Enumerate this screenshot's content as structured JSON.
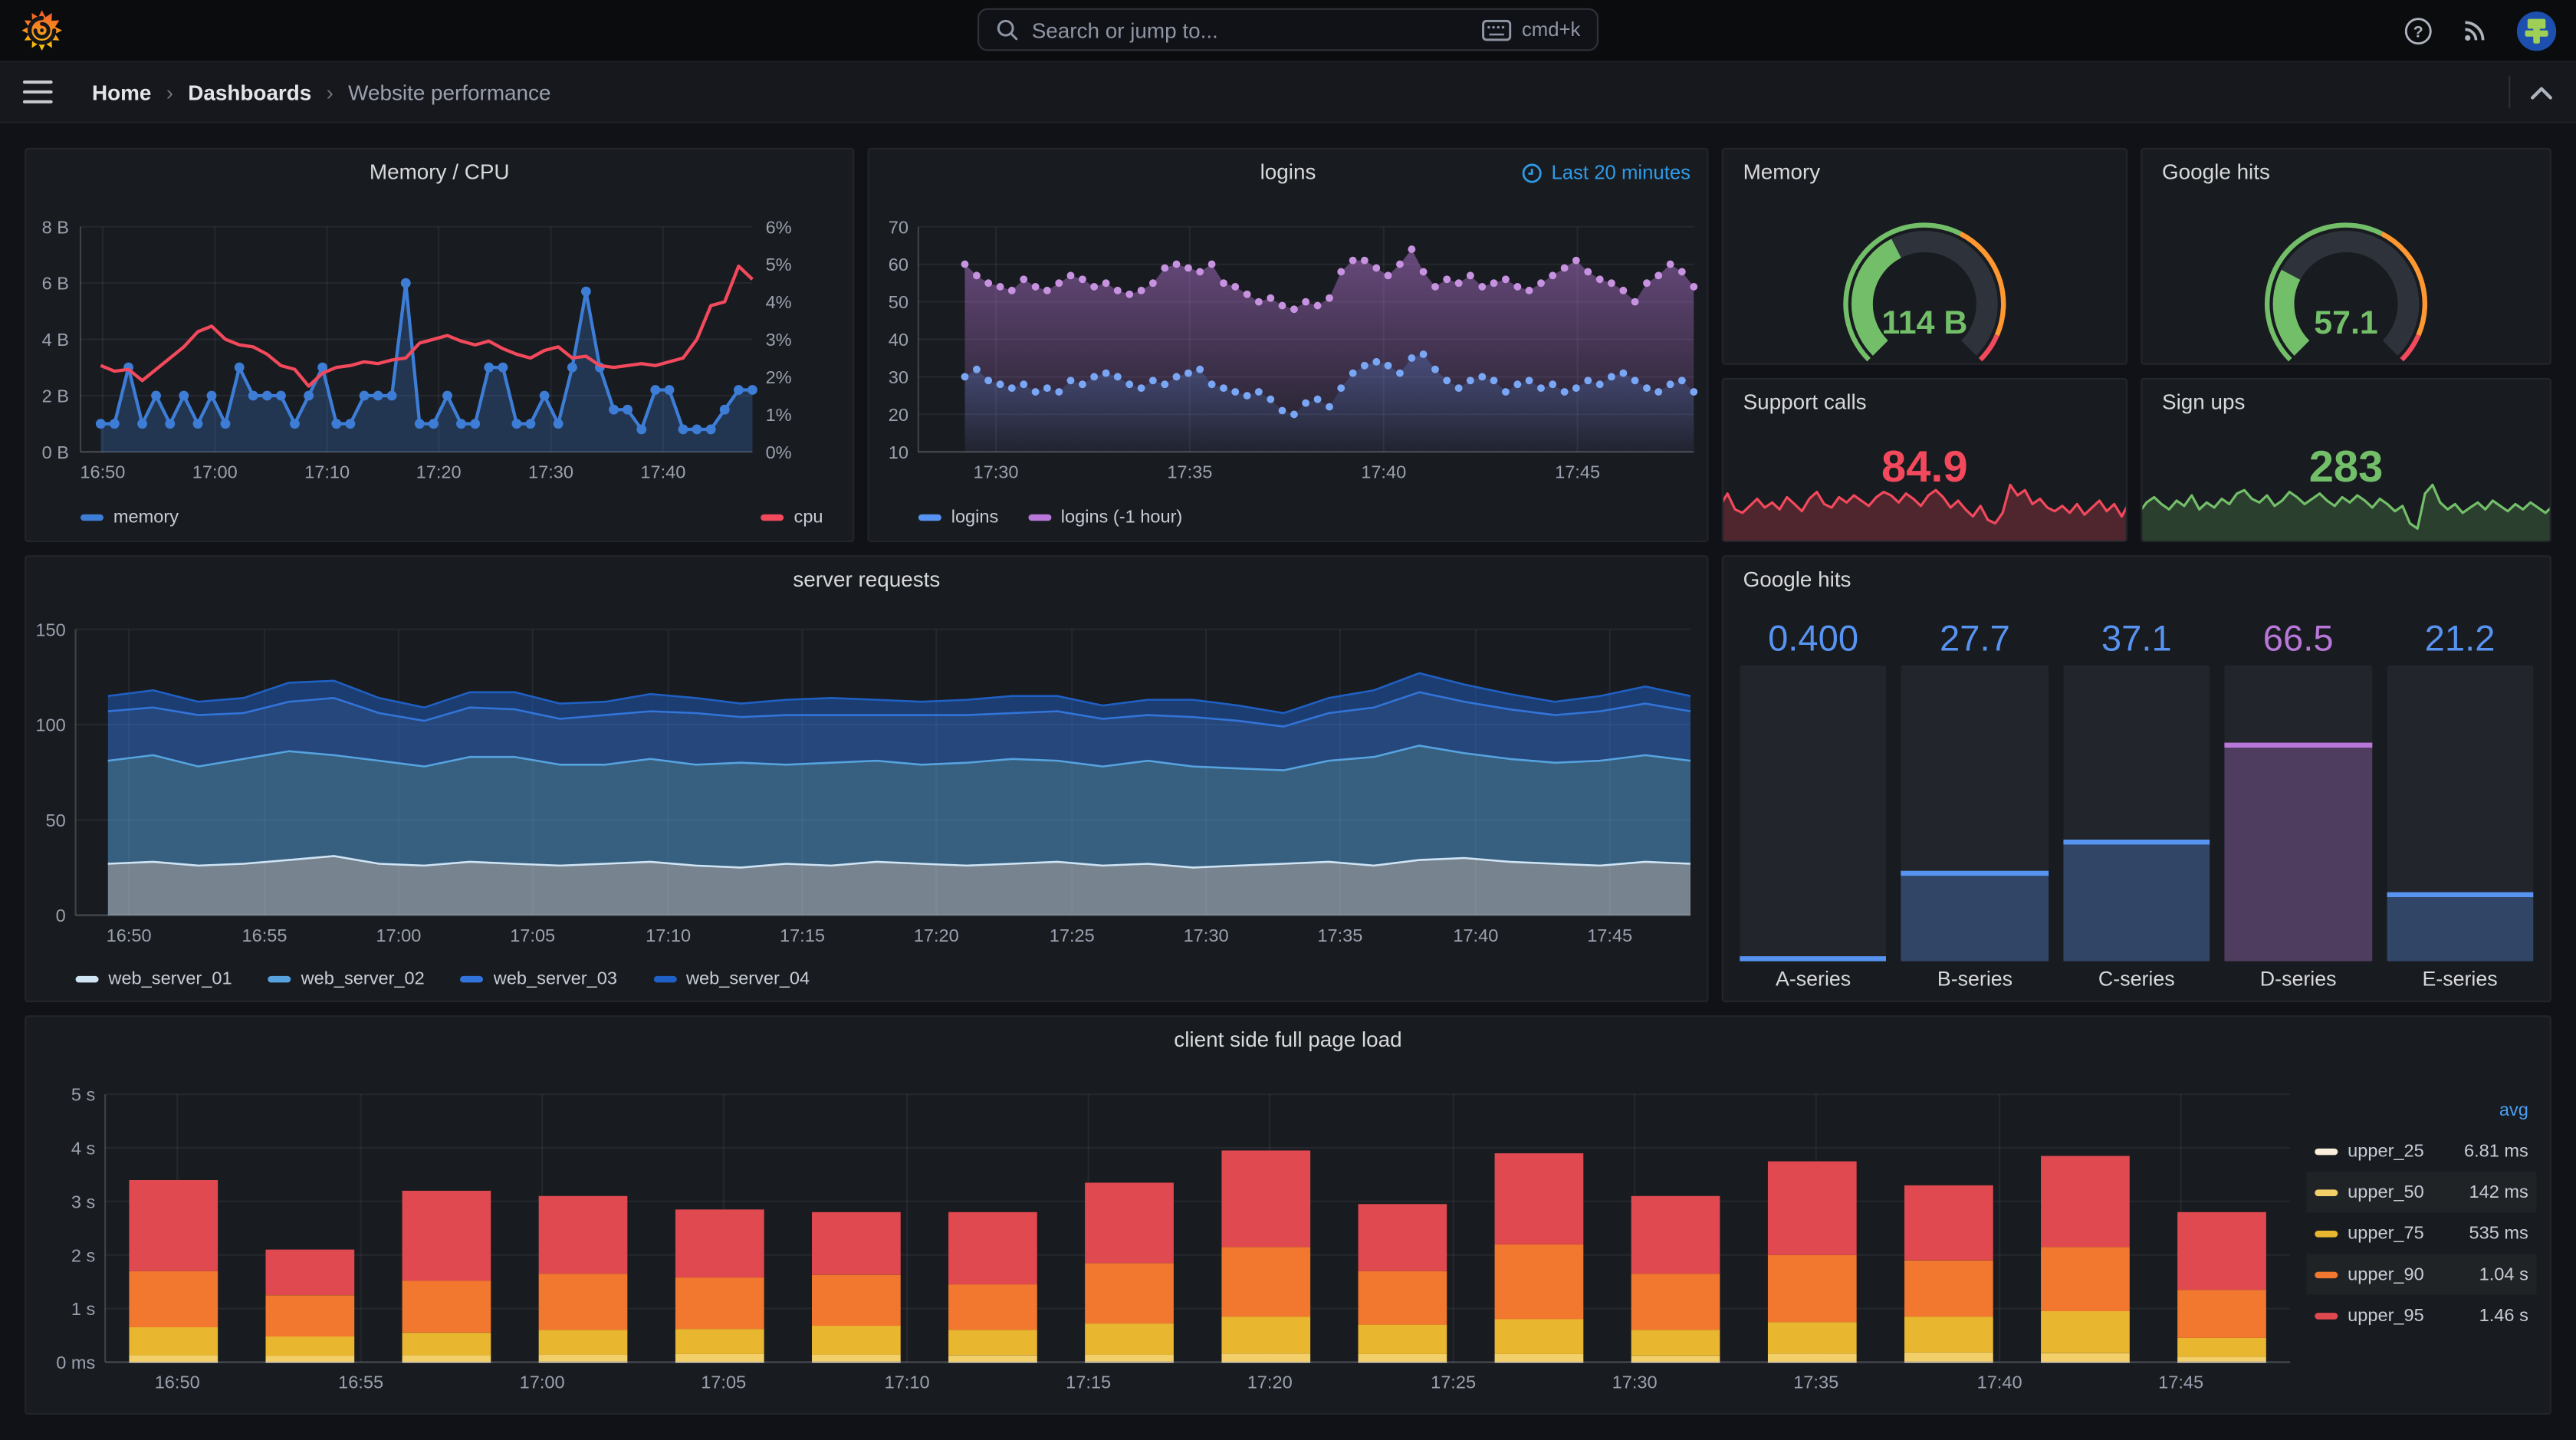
{
  "ui": {
    "topnav": {
      "search_placeholder": "Search or jump to...",
      "shortcut_label": "cmd+k",
      "icons": [
        "grafana-logo",
        "search-icon",
        "keyboard-icon",
        "help-icon",
        "rss-icon",
        "user-avatar"
      ]
    },
    "breadcrumb": {
      "items": [
        "Home",
        "Dashboards",
        "Website performance"
      ],
      "separator": "›"
    },
    "colors": {
      "page_bg": "#111217",
      "panel_bg": "#181b1f",
      "accent_blue": "#5794F2",
      "purple": "#B877D9",
      "green": "#73BF69",
      "red": "#F2495C",
      "orange": "#FF9830",
      "link_blue": "#2f9be8"
    }
  },
  "chart_data": [
    {
      "id": "memory_cpu",
      "type": "line",
      "title": "Memory / CPU",
      "x_ticks": [
        "16:50",
        "17:00",
        "17:10",
        "17:20",
        "17:30",
        "17:40"
      ],
      "x_tick_fracs": [
        0.033,
        0.2,
        0.367,
        0.533,
        0.7,
        0.867
      ],
      "y_left": {
        "ticks": [
          "8 B",
          "6 B",
          "4 B",
          "2 B",
          "0 B"
        ],
        "min": 0,
        "max": 8
      },
      "y_right": {
        "ticks": [
          "6%",
          "5%",
          "4%",
          "3%",
          "2%",
          "1%",
          "0%"
        ],
        "min": 0,
        "max": 6
      },
      "series": [
        {
          "name": "memory",
          "axis": "left",
          "color": "#3D7DD6",
          "fill": "rgba(61,125,214,0.28)",
          "values": [
            1,
            1,
            3,
            1,
            2,
            1,
            2,
            1,
            2,
            1,
            3,
            2,
            2,
            2,
            1,
            2,
            3,
            1,
            1,
            2,
            2,
            2,
            6,
            1,
            1,
            2,
            1,
            1,
            3,
            3,
            1,
            1,
            2,
            1,
            3,
            5.7,
            3,
            1.5,
            1.5,
            0.8,
            2.2,
            2.2,
            0.8,
            0.8,
            0.8,
            1.5,
            2.2,
            2.2
          ]
        },
        {
          "name": "cpu",
          "axis": "right",
          "color": "#F2495C",
          "values": [
            2.3,
            2.15,
            2.2,
            1.9,
            2.2,
            2.5,
            2.8,
            3.2,
            3.35,
            3.0,
            2.85,
            2.8,
            2.6,
            2.3,
            2.2,
            1.75,
            2.1,
            2.25,
            2.3,
            2.4,
            2.35,
            2.45,
            2.5,
            2.9,
            3.0,
            3.1,
            2.95,
            2.85,
            2.95,
            2.75,
            2.6,
            2.5,
            2.7,
            2.8,
            2.5,
            2.55,
            2.3,
            2.25,
            2.3,
            2.35,
            2.3,
            2.4,
            2.5,
            3.0,
            3.9,
            4.0,
            4.95,
            4.6
          ]
        }
      ]
    },
    {
      "id": "logins",
      "type": "scatter-area",
      "title": "logins",
      "time_range": "Last 20 minutes",
      "x_ticks": [
        "17:30",
        "17:35",
        "17:40",
        "17:45"
      ],
      "x_tick_fracs": [
        0.1,
        0.35,
        0.6,
        0.85
      ],
      "y_ticks": [
        70,
        60,
        50,
        40,
        30,
        20,
        10
      ],
      "ylim": [
        10,
        70
      ],
      "series": [
        {
          "name": "logins",
          "color": "#5794F2",
          "dot": "#7AA7F5",
          "values": [
            30,
            32,
            29,
            28,
            27,
            28,
            26,
            27,
            26,
            29,
            28,
            30,
            31,
            30,
            28,
            27,
            29,
            28,
            30,
            31,
            32,
            28,
            27,
            26,
            25,
            26,
            24,
            21,
            20,
            23,
            24,
            22,
            27,
            31,
            33,
            34,
            33,
            31,
            35,
            36,
            32,
            29,
            27,
            29,
            30,
            29,
            26,
            28,
            29,
            27,
            28,
            26,
            27,
            29,
            28,
            30,
            31,
            29,
            27,
            26,
            28,
            29,
            26
          ]
        },
        {
          "name": "logins (-1 hour)",
          "color": "#B877D9",
          "dot": "#C792E0",
          "values": [
            60,
            57,
            55,
            54,
            53,
            56,
            54,
            53,
            55,
            57,
            56,
            54,
            55,
            53,
            52,
            53,
            55,
            59,
            60,
            59,
            58,
            60,
            55,
            54,
            52,
            50,
            51,
            49,
            48,
            50,
            49,
            51,
            58,
            61,
            61,
            59,
            57,
            60,
            64,
            58,
            54,
            56,
            55,
            57,
            54,
            55,
            56,
            54,
            53,
            55,
            57,
            59,
            61,
            58,
            56,
            55,
            53,
            50,
            55,
            57,
            60,
            58,
            54
          ]
        }
      ]
    },
    {
      "id": "server_requests",
      "type": "area-stacked",
      "title": "server requests",
      "x_ticks": [
        "16:50",
        "16:55",
        "17:00",
        "17:05",
        "17:10",
        "17:15",
        "17:20",
        "17:25",
        "17:30",
        "17:35",
        "17:40",
        "17:45"
      ],
      "x_tick_fracs": [
        0.033,
        0.117,
        0.2,
        0.283,
        0.367,
        0.45,
        0.533,
        0.617,
        0.7,
        0.783,
        0.867,
        0.95
      ],
      "y_ticks": [
        150,
        100,
        50,
        0
      ],
      "ylim": [
        0,
        150
      ],
      "series": [
        {
          "name": "web_server_01",
          "color": "#CFE4F5",
          "fill": "rgba(207,228,245,0.52)",
          "values": [
            27,
            28,
            26,
            27,
            29,
            31,
            27,
            26,
            28,
            27,
            26,
            27,
            28,
            26,
            25,
            27,
            26,
            28,
            27,
            26,
            27,
            28,
            26,
            27,
            25,
            26,
            27,
            28,
            26,
            29,
            30,
            28,
            27,
            26,
            28,
            27
          ]
        },
        {
          "name": "web_server_02",
          "color": "#56A3E0",
          "fill": "rgba(86,163,224,0.5)",
          "values": [
            54,
            56,
            52,
            55,
            57,
            53,
            54,
            52,
            55,
            56,
            53,
            52,
            54,
            53,
            55,
            52,
            54,
            53,
            52,
            54,
            55,
            53,
            52,
            54,
            53,
            51,
            49,
            53,
            57,
            60,
            55,
            54,
            53,
            55,
            56,
            54
          ]
        },
        {
          "name": "web_server_03",
          "color": "#3274D9",
          "fill": "rgba(50,116,217,0.5)",
          "values": [
            26,
            25,
            27,
            24,
            26,
            30,
            25,
            24,
            26,
            25,
            24,
            26,
            25,
            27,
            24,
            26,
            25,
            24,
            26,
            25,
            24,
            26,
            25,
            24,
            26,
            25,
            23,
            25,
            26,
            28,
            27,
            26,
            25,
            26,
            27,
            26
          ]
        },
        {
          "name": "web_server_04",
          "color": "#1F60C4",
          "fill": "rgba(31,96,196,0.5)",
          "values": [
            8,
            9,
            7,
            8,
            10,
            9,
            8,
            7,
            8,
            9,
            8,
            7,
            9,
            8,
            7,
            8,
            9,
            8,
            7,
            8,
            9,
            8,
            7,
            8,
            9,
            8,
            7,
            8,
            9,
            10,
            9,
            8,
            7,
            8,
            9,
            8
          ]
        }
      ]
    },
    {
      "id": "google_hits_bars",
      "type": "bar",
      "title": "Google hits",
      "categories": [
        "A-series",
        "B-series",
        "C-series",
        "D-series",
        "E-series"
      ],
      "values": [
        0.4,
        27.7,
        37.1,
        66.5,
        21.2
      ],
      "display_values": [
        "0.400",
        "27.7",
        "37.1",
        "66.5",
        "21.2"
      ],
      "value_colors": [
        "#5794F2",
        "#5794F2",
        "#5794F2",
        "#B877D9",
        "#5794F2"
      ],
      "fill_colors": [
        "rgba(87,148,242,0.3)",
        "rgba(87,148,242,0.3)",
        "rgba(87,148,242,0.3)",
        "rgba(184,119,217,0.3)",
        "rgba(87,148,242,0.3)"
      ],
      "max": 90
    },
    {
      "id": "client_load",
      "type": "bar-stacked",
      "title": "client side full page load",
      "y_ticks": [
        "5 s",
        "4 s",
        "3 s",
        "2 s",
        "1 s",
        "0 ms"
      ],
      "ymax": 5,
      "x_ticks": [
        "16:50",
        "16:55",
        "17:00",
        "17:05",
        "17:10",
        "17:15",
        "17:20",
        "17:25",
        "17:30",
        "17:35",
        "17:40",
        "17:45"
      ],
      "x_tick_fracs": [
        0.033,
        0.117,
        0.2,
        0.283,
        0.367,
        0.45,
        0.533,
        0.617,
        0.7,
        0.783,
        0.867,
        0.95
      ],
      "seg_colors": [
        "#FBEEDC",
        "#F2CF68",
        "#E9B62F",
        "#F1782E",
        "#E0494F"
      ],
      "legend": {
        "header": "avg",
        "rows": [
          {
            "name": "upper_25",
            "value": "6.81 ms",
            "color": "#FBEEDC"
          },
          {
            "name": "upper_50",
            "value": "142 ms",
            "color": "#F2CF68"
          },
          {
            "name": "upper_75",
            "value": "535 ms",
            "color": "#E9B62F"
          },
          {
            "name": "upper_90",
            "value": "1.04 s",
            "color": "#F1782E"
          },
          {
            "name": "upper_95",
            "value": "1.46 s",
            "color": "#E0494F"
          }
        ]
      },
      "bars": [
        [
          0.01,
          0.12,
          0.52,
          1.05,
          1.7
        ],
        [
          0.01,
          0.11,
          0.36,
          0.77,
          0.85
        ],
        [
          0.01,
          0.12,
          0.42,
          0.97,
          1.68
        ],
        [
          0.01,
          0.13,
          0.46,
          1.05,
          1.45
        ],
        [
          0.01,
          0.14,
          0.47,
          0.96,
          1.27
        ],
        [
          0.01,
          0.13,
          0.54,
          0.95,
          1.17
        ],
        [
          0.01,
          0.12,
          0.47,
          0.85,
          1.35
        ],
        [
          0.01,
          0.13,
          0.58,
          1.13,
          1.5
        ],
        [
          0.01,
          0.15,
          0.69,
          1.3,
          1.8
        ],
        [
          0.01,
          0.14,
          0.55,
          1.0,
          1.25
        ],
        [
          0.01,
          0.14,
          0.65,
          1.4,
          1.7
        ],
        [
          0.01,
          0.11,
          0.48,
          1.05,
          1.45
        ],
        [
          0.01,
          0.15,
          0.59,
          1.25,
          1.75
        ],
        [
          0.01,
          0.17,
          0.67,
          1.05,
          1.4
        ],
        [
          0.01,
          0.16,
          0.78,
          1.2,
          1.7
        ],
        [
          0.01,
          0.09,
          0.35,
          0.9,
          1.45
        ]
      ]
    },
    {
      "id": "memory_gauge",
      "type": "gauge",
      "title": "Memory",
      "value": "114 B",
      "fraction": 0.4,
      "color": "#73BF69",
      "thresholds": [
        {
          "frac": 0.6,
          "color": "#73BF69"
        },
        {
          "frac": 0.92,
          "color": "#FF9830"
        },
        {
          "frac": 1,
          "color": "#F2495C"
        }
      ]
    },
    {
      "id": "google_hits_gauge",
      "type": "gauge",
      "title": "Google hits",
      "value": "57.1",
      "fraction": 0.27,
      "color": "#73BF69",
      "thresholds": [
        {
          "frac": 0.6,
          "color": "#73BF69"
        },
        {
          "frac": 0.92,
          "color": "#FF9830"
        },
        {
          "frac": 1,
          "color": "#F2495C"
        }
      ]
    },
    {
      "id": "support_calls",
      "type": "stat",
      "title": "Support calls",
      "value": "84.9",
      "color": "#F2495C",
      "fill": "rgba(242,73,92,0.25)",
      "spark": [
        18,
        25,
        16,
        14,
        18,
        22,
        17,
        20,
        16,
        23,
        19,
        15,
        22,
        26,
        19,
        17,
        23,
        20,
        24,
        21,
        18,
        23,
        26,
        24,
        20,
        25,
        22,
        18,
        24,
        27,
        23,
        17,
        21,
        16,
        12,
        18,
        10,
        8,
        14,
        30,
        24,
        27,
        19,
        22,
        17,
        15,
        18,
        14,
        19,
        13,
        17,
        21,
        15,
        19,
        12,
        20
      ]
    },
    {
      "id": "sign_ups",
      "type": "stat",
      "title": "Sign ups",
      "value": "283",
      "color": "#73BF69",
      "fill": "rgba(115,191,105,0.22)",
      "spark": [
        14,
        20,
        23,
        19,
        16,
        21,
        18,
        24,
        16,
        20,
        17,
        22,
        19,
        25,
        27,
        22,
        20,
        24,
        18,
        21,
        26,
        23,
        19,
        22,
        25,
        21,
        18,
        23,
        20,
        24,
        21,
        17,
        22,
        19,
        15,
        18,
        8,
        5,
        25,
        30,
        20,
        16,
        19,
        14,
        17,
        20,
        16,
        21,
        18,
        15,
        19,
        16,
        20,
        17,
        14,
        18
      ]
    }
  ]
}
